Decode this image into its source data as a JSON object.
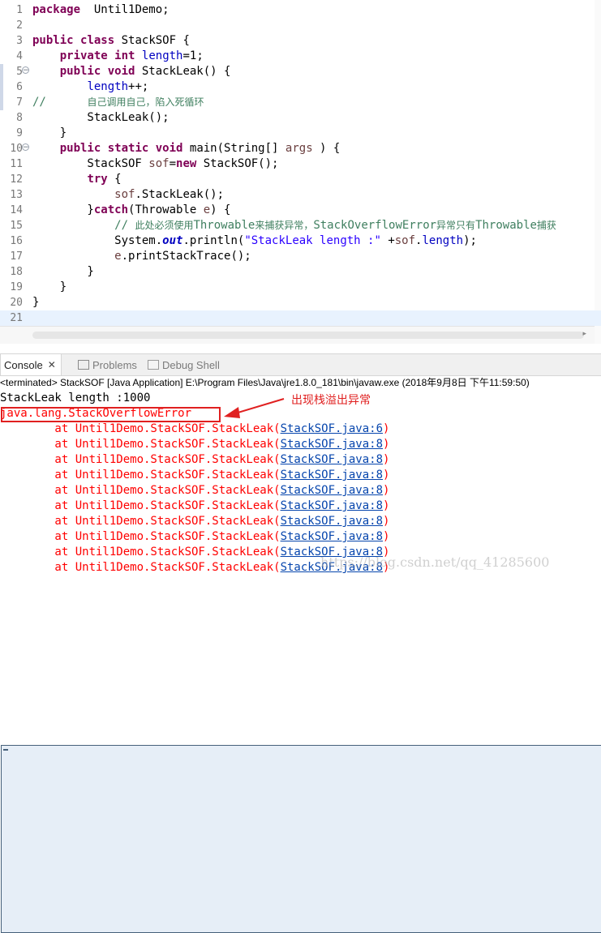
{
  "editor": {
    "lines": [
      {
        "num": "1",
        "segs": [
          [
            "kw",
            "package"
          ],
          [
            "",
            "  Until1Demo;"
          ]
        ]
      },
      {
        "num": "2",
        "segs": []
      },
      {
        "num": "3",
        "segs": [
          [
            "kw",
            "public"
          ],
          [
            "",
            " "
          ],
          [
            "kw",
            "class"
          ],
          [
            "",
            " StackSOF {"
          ]
        ]
      },
      {
        "num": "4",
        "segs": [
          [
            "",
            "    "
          ],
          [
            "kw",
            "private"
          ],
          [
            "",
            " "
          ],
          [
            "kw",
            "int"
          ],
          [
            "",
            " "
          ],
          [
            "fld",
            "length"
          ],
          [
            "",
            "=1;"
          ]
        ]
      },
      {
        "num": "5",
        "fold": true,
        "segs": [
          [
            "",
            "    "
          ],
          [
            "kw",
            "public"
          ],
          [
            "",
            " "
          ],
          [
            "kw",
            "void"
          ],
          [
            "",
            " StackLeak() {"
          ]
        ]
      },
      {
        "num": "6",
        "segs": [
          [
            "",
            "        "
          ],
          [
            "fld",
            "length"
          ],
          [
            "",
            "++;"
          ]
        ]
      },
      {
        "num": "7",
        "segs": [
          [
            "cmt",
            "//      "
          ],
          [
            "cmt cn",
            "自己调用自己，陷入死循环"
          ]
        ]
      },
      {
        "num": "8",
        "segs": [
          [
            "",
            "        StackLeak();"
          ]
        ]
      },
      {
        "num": "9",
        "segs": [
          [
            "",
            "    }"
          ]
        ]
      },
      {
        "num": "10",
        "fold": true,
        "segs": [
          [
            "",
            "    "
          ],
          [
            "kw",
            "public"
          ],
          [
            "",
            " "
          ],
          [
            "kw",
            "static"
          ],
          [
            "",
            " "
          ],
          [
            "kw",
            "void"
          ],
          [
            "",
            " main(String[] "
          ],
          [
            "loc",
            "args"
          ],
          [
            "",
            " ) {"
          ]
        ]
      },
      {
        "num": "11",
        "segs": [
          [
            "",
            "        StackSOF "
          ],
          [
            "loc",
            "sof"
          ],
          [
            "",
            "="
          ],
          [
            "kw",
            "new"
          ],
          [
            "",
            " StackSOF();"
          ]
        ]
      },
      {
        "num": "12",
        "segs": [
          [
            "",
            "        "
          ],
          [
            "kw",
            "try"
          ],
          [
            "",
            " {"
          ]
        ]
      },
      {
        "num": "13",
        "segs": [
          [
            "",
            "            "
          ],
          [
            "loc",
            "sof"
          ],
          [
            "",
            ".StackLeak();"
          ]
        ]
      },
      {
        "num": "14",
        "segs": [
          [
            "",
            "        }"
          ],
          [
            "kw",
            "catch"
          ],
          [
            "",
            "(Throwable "
          ],
          [
            "loc",
            "e"
          ],
          [
            "",
            ") {"
          ]
        ]
      },
      {
        "num": "15",
        "segs": [
          [
            "cmt",
            "            // "
          ],
          [
            "cmt cn",
            "此处必须使用"
          ],
          [
            "cmt",
            "Throwable"
          ],
          [
            "cmt cn",
            "来捕获异常，"
          ],
          [
            "cmt",
            "StackOverflowError"
          ],
          [
            "cmt cn",
            "异常只有"
          ],
          [
            "cmt",
            "Throwable"
          ],
          [
            "cmt cn",
            "捕获"
          ]
        ]
      },
      {
        "num": "16",
        "segs": [
          [
            "",
            "            System."
          ],
          [
            "stf",
            "out"
          ],
          [
            "",
            ".println("
          ],
          [
            "str",
            "\"StackLeak length :\""
          ],
          [
            "",
            " +"
          ],
          [
            "loc",
            "sof"
          ],
          [
            "",
            "."
          ],
          [
            "fld",
            "length"
          ],
          [
            "",
            ");"
          ]
        ]
      },
      {
        "num": "17",
        "segs": [
          [
            "",
            "            "
          ],
          [
            "loc",
            "e"
          ],
          [
            "",
            ".printStackTrace();"
          ]
        ]
      },
      {
        "num": "18",
        "segs": [
          [
            "",
            "        }"
          ]
        ]
      },
      {
        "num": "19",
        "segs": [
          [
            "",
            "    }"
          ]
        ]
      },
      {
        "num": "20",
        "segs": [
          [
            "",
            "}"
          ]
        ]
      },
      {
        "num": "21",
        "segs": [],
        "current": true
      }
    ]
  },
  "tabs": [
    {
      "label": "Console",
      "close": "✕",
      "active": true
    },
    {
      "label": "Problems",
      "active": false
    },
    {
      "label": "Debug Shell",
      "active": false
    }
  ],
  "console": {
    "status": "<terminated> StackSOF [Java Application] E:\\Program Files\\Java\\jre1.8.0_181\\bin\\javaw.exe (2018年9月8日 下午11:59:50)",
    "output": "StackLeak length :1000",
    "error": "java.lang.StackOverflowError",
    "frame_prefix": "        at Until1Demo.StackSOF.StackLeak(",
    "frame_suffix": ")",
    "frames": [
      "StackSOF.java:6",
      "StackSOF.java:8",
      "StackSOF.java:8",
      "StackSOF.java:8",
      "StackSOF.java:8",
      "StackSOF.java:8",
      "StackSOF.java:8",
      "StackSOF.java:8",
      "StackSOF.java:8",
      "StackSOF.java:8"
    ],
    "annotation": "出现栈溢出异常"
  },
  "watermark": "https://blog.csdn.net/qq_41285600",
  "colors": {
    "keyword": "#7f0055",
    "field": "#0000c0",
    "string": "#2a00ff",
    "comment": "#3f7f5f",
    "error": "#ff0000",
    "link": "#0645ad",
    "annotation": "#e02020"
  }
}
